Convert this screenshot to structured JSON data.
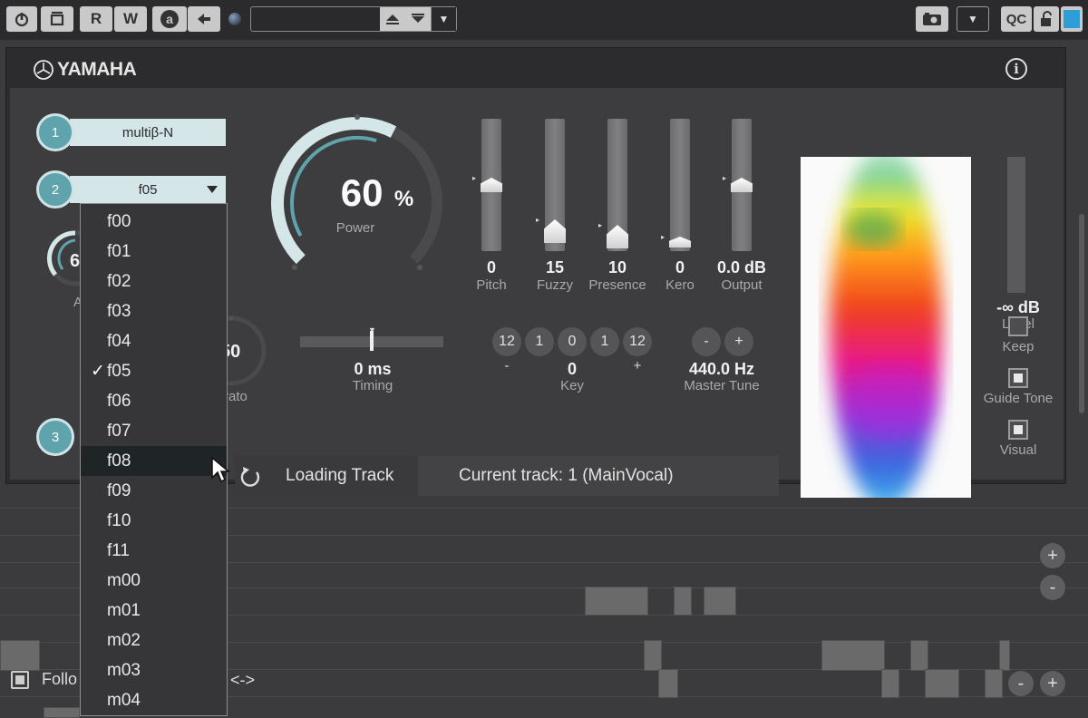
{
  "toolbar": {
    "rec_r": "R",
    "rec_w": "W",
    "auto": "a",
    "qc": "QC"
  },
  "plugin": {
    "brand": "YAMAHA",
    "info_symbol": "i",
    "slot1": {
      "number": "1",
      "label": "multiβ-N"
    },
    "slot2": {
      "number": "2",
      "label": "f05"
    },
    "slot3": {
      "number": "3"
    },
    "power": {
      "value": "60",
      "unit": "%",
      "label": "Power",
      "level": 0.6
    },
    "partial_knob": {
      "value": "6",
      "label": "A"
    },
    "vibrato": {
      "value": "50",
      "label": "rato"
    },
    "sliders": [
      {
        "value": "0",
        "label": "Pitch",
        "level": 0.5
      },
      {
        "value": "15",
        "label": "Fuzzy",
        "level": 0.15
      },
      {
        "value": "10",
        "label": "Presence",
        "level": 0.1
      },
      {
        "value": "0",
        "label": "Kero",
        "level": 0.0
      },
      {
        "value": "0.0 dB",
        "label": "Output",
        "level": 0.5
      }
    ],
    "timing": {
      "value": "0 ms",
      "label": "Timing"
    },
    "key": {
      "buttons": [
        "12",
        "1",
        "0",
        "1",
        "12"
      ],
      "minus": "-",
      "plus": "+",
      "value": "0",
      "label": "Key"
    },
    "master_tune": {
      "minus": "-",
      "plus": "+",
      "value": "440.0 Hz",
      "label": "Master Tune"
    },
    "level_meter": {
      "value": "-∞ dB",
      "label": "Level"
    },
    "toggles": [
      {
        "label": "Keep",
        "checked": false
      },
      {
        "label": "Guide Tone",
        "checked": true
      },
      {
        "label": "Visual",
        "checked": true
      }
    ],
    "loading": {
      "label": "Loading Track",
      "number": "1",
      "current": "Current track: 1 (MainVocal)"
    }
  },
  "dropdown": {
    "items": [
      "f00",
      "f01",
      "f02",
      "f03",
      "f04",
      "f05",
      "f06",
      "f07",
      "f08",
      "f09",
      "f10",
      "f11",
      "m00",
      "m01",
      "m02",
      "m03",
      "m04"
    ],
    "selected": "f05",
    "hovered": "f08",
    "check_symbol": "✓"
  },
  "arrangement": {
    "follow_label": "Follo",
    "arrows_label": "<->",
    "plus": "+",
    "minus": "-"
  },
  "colors": {
    "accent_teal": "#5fa3ad",
    "pill_bg": "#d4e6e8",
    "panel_bg": "#3d3d3f",
    "transport_blue": "#2e9fd6"
  }
}
